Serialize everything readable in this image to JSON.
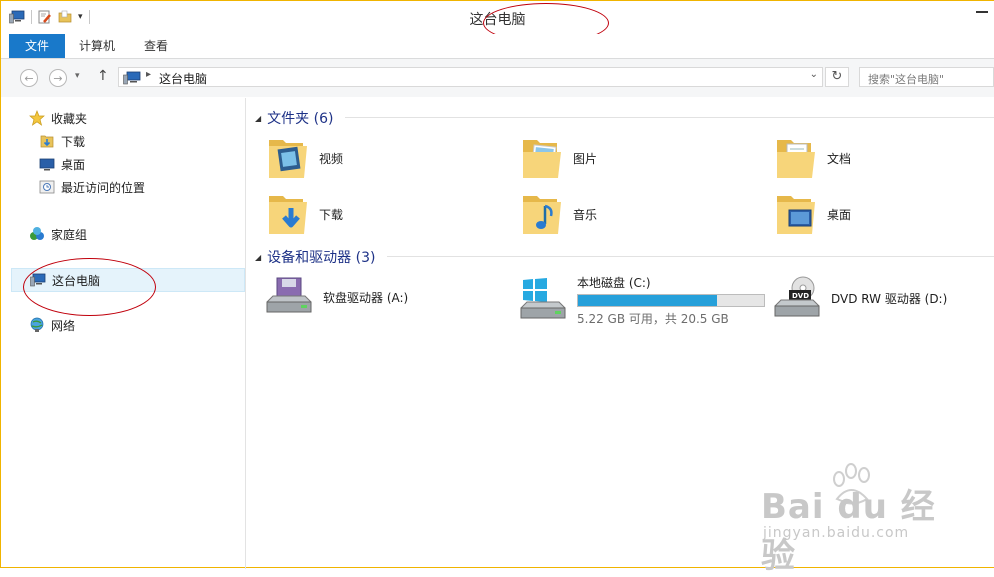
{
  "window": {
    "title": "这台电脑"
  },
  "ribbon": {
    "tabs": [
      {
        "label": "文件"
      },
      {
        "label": "计算机"
      },
      {
        "label": "查看"
      }
    ]
  },
  "address": {
    "crumb": "这台电脑",
    "search_placeholder": "搜索\"这台电脑\""
  },
  "navpane": {
    "favorites": "收藏夹",
    "downloads": "下载",
    "desktop": "桌面",
    "recent": "最近访问的位置",
    "homegroup": "家庭组",
    "thispc": "这台电脑",
    "network": "网络"
  },
  "folders": {
    "header": "文件夹 (6)",
    "items": [
      {
        "label": "视频",
        "icon": "video-folder-icon"
      },
      {
        "label": "图片",
        "icon": "pictures-folder-icon"
      },
      {
        "label": "文档",
        "icon": "documents-folder-icon"
      },
      {
        "label": "下载",
        "icon": "downloads-folder-icon"
      },
      {
        "label": "音乐",
        "icon": "music-folder-icon"
      },
      {
        "label": "桌面",
        "icon": "desktop-folder-icon"
      }
    ]
  },
  "devices": {
    "header": "设备和驱动器 (3)",
    "floppy": {
      "label": "软盘驱动器 (A:)"
    },
    "local": {
      "label": "本地磁盘 (C:)",
      "usage": "5.22 GB 可用，共 20.5 GB",
      "used_fraction": 0.745
    },
    "dvd": {
      "label": "DVD RW 驱动器 (D:)",
      "badge": "DVD"
    }
  },
  "watermark": {
    "brand": "Bai du 经验",
    "url": "jingyan.baidu.com"
  },
  "colors": {
    "accent": "#1979ca",
    "header": "#1e3287",
    "bar": "#26a0da",
    "border": "#f0b400",
    "annotation": "#c0000c"
  }
}
